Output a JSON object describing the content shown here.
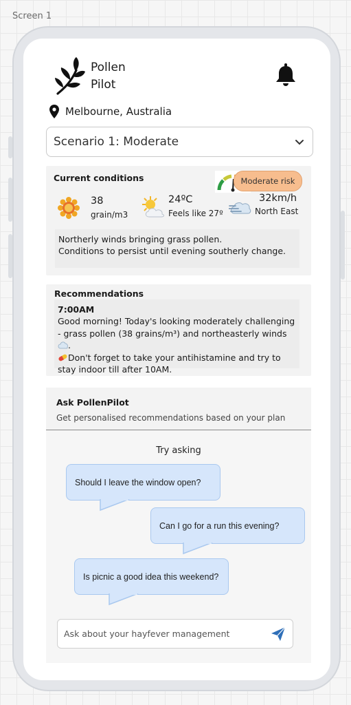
{
  "canvas_label": "Screen 1",
  "app": {
    "title_line1": "Pollen",
    "title_line2": "Pilot",
    "logo_icon": "leaf-branch-icon",
    "notification_icon": "bell-icon"
  },
  "location": {
    "icon": "map-pin-icon",
    "text": "Melbourne, Australia"
  },
  "scenario_select": {
    "value": "Scenario 1: Moderate",
    "icon": "chevron-down-icon"
  },
  "current_conditions": {
    "title": "Current conditions",
    "risk_badge": "Moderate risk",
    "gauge_icon": "risk-gauge-icon",
    "pollen": {
      "icon": "pollen-flower-icon",
      "value": "38",
      "unit": "grain/m3"
    },
    "temperature": {
      "icon": "sun-cloud-icon",
      "value": "24ºC",
      "feels_like": "Feels like 27º"
    },
    "wind": {
      "icon": "wind-icon",
      "value": "32km/h",
      "direction": "North East"
    },
    "note_line1": "Northerly winds bringing grass pollen.",
    "note_line2": "Conditions to persist until evening southerly change."
  },
  "recommendations": {
    "title": "Recommendations",
    "time": "7:00AM",
    "text_part1": "Good morning! Today's looking moderately challenging - grass pollen (38 grains/m³) and northeasterly winds",
    "text_part2": "Don't forget to take your antihistamine and try to stay indoor till after 10AM."
  },
  "ask": {
    "title": "Ask PollenPilot",
    "subtitle": "Get personalised recommendations based on your plan",
    "try_label": "Try asking",
    "suggestions": [
      "Should I leave the window open?",
      "Can I go for a run this evening?",
      "Is picnic a good idea this weekend?"
    ],
    "input_placeholder": "Ask about your hayfever management",
    "send_icon": "send-icon"
  },
  "colors": {
    "risk_badge": "#f7bd8e",
    "bubble": "#d6e6fb",
    "send": "#2f6fb8"
  }
}
